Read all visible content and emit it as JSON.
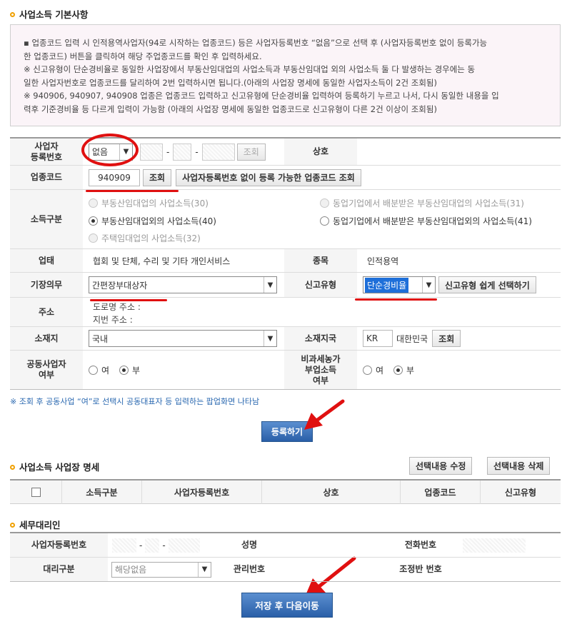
{
  "section1": {
    "title": "사업소득 기본사항"
  },
  "notice": {
    "line1": "업종코드 입력 시 인적용역사업자(94로 시작하는 업종코드) 등은 사업자등록번호 “없음”으로 선택 후 (사업자등록번호 없이 등록가능",
    "line2": "한 업종코드) 버튼을 클릭하여 해당 주업종코드를 확인 후 입력하세요.",
    "line3": "※ 신고유형이 단순경비율로 동일한 사업장에서 부동산임대업의 사업소득과 부동산임대업 외의 사업소득 둘 다 발생하는 경우에는 동",
    "line4": "일한 사업자번호로 업종코드를 달리하여 2번 입력하시면 됩니다.(아래의 사업장 명세에 동일한 사업자소득이 2건 조회됨)",
    "line5": "※ 940906, 940907, 940908 업종은 업종코드 입력하고 신고유형에 단순경비율 입력하여 등록하기 누르고 나서, 다시 동일한 내용을 입",
    "line6": "력후 기준경비율 등 다르게 입력이 가능함 (아래의 사업장 명세에 동일한 업종코드로 신고유형이 다른 2건 이상이 조회됨)"
  },
  "form": {
    "bizno_label": "사업자\n등록번호",
    "bizno_select": "없음",
    "dash": "-",
    "lookup": "조회",
    "trade_name_label": "상호",
    "industry_code_label": "업종코드",
    "industry_code_value": "940909",
    "industry_lookup": "조회",
    "no_bizno_lookup": "사업자등록번호 없이 등록 가능한 업종코드 조회",
    "income_type_label": "소득구분",
    "income_options": [
      "부동산임대업의 사업소득(30)",
      "부동산임대업외의 사업소득(40)",
      "주택임대업의 사업소득(32)",
      "동업기업에서 배분받은 부동산임대업의 사업소득(31)",
      "동업기업에서 배분받은 부동산임대업외의 사업소득(41)"
    ],
    "business_type_label": "업태",
    "business_type_value": "협회 및 단체, 수리 및 기타 개인서비스",
    "item_label": "종목",
    "item_value": "인적용역",
    "bookkeeping_label": "기장의무",
    "bookkeeping_value": "간편장부대상자",
    "report_type_label": "신고유형",
    "report_type_value": "단순경비율",
    "report_type_easy": "신고유형 쉽게 선택하기",
    "address_label": "주소",
    "road_address": "도로명 주소 :",
    "lot_address": "지번 주소 :",
    "location_label": "소재지",
    "location_value": "국내",
    "country_label": "소재지국",
    "country_code": "KR",
    "country_name": "대한민국",
    "country_lookup": "조회",
    "joint_label": "공동사업자\n여부",
    "yes": "여",
    "no": "부",
    "taxfree_label": "비과세농가\n부업소득\n여부"
  },
  "note": "※ 조회 후 공동사업 “여”로 선택시 공동대표자 등 입력하는 팝업화면 나타남",
  "register_button": "등록하기",
  "section2": {
    "title": "사업소득 사업장 명세",
    "edit_button": "선택내용 수정",
    "delete_button": "선택내용 삭제",
    "columns": [
      "소득구분",
      "사업자등록번호",
      "상호",
      "업종코드",
      "신고유형"
    ]
  },
  "section3": {
    "title": "세무대리인",
    "bizno_label": "사업자등록번호",
    "name_label": "성명",
    "phone_label": "전화번호",
    "agent_type_label": "대리구분",
    "agent_type_value": "해당없음",
    "mgmt_no_label": "관리번호",
    "team_no_label": "조정반 번호"
  },
  "save_button": "저장 후 다음이동",
  "colors": {
    "annotation_red": "#e01010",
    "primary_blue": "#2a5fa8",
    "highlight_select": "#1e6fd9"
  }
}
